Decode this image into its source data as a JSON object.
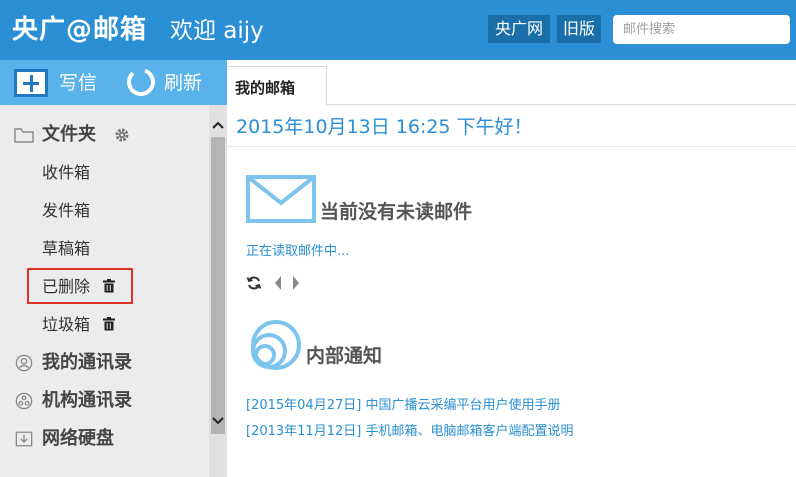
{
  "header": {
    "brand": "央广@邮箱",
    "welcome": "欢迎 aijy",
    "buttons": [
      "央广网",
      "旧版"
    ],
    "search_placeholder": "邮件搜索"
  },
  "toolbar": {
    "write_label": "写信",
    "refresh_label": "刷新"
  },
  "tabs": [
    {
      "label": "我的邮箱"
    }
  ],
  "sidebar": {
    "folders_label": "文件夹",
    "folder_items": [
      {
        "label": "收件箱"
      },
      {
        "label": "发件箱"
      },
      {
        "label": "草稿箱"
      },
      {
        "label": "已删除"
      },
      {
        "label": "垃圾箱"
      }
    ],
    "sections": [
      {
        "label": "我的通讯录"
      },
      {
        "label": "机构通讯录"
      },
      {
        "label": "网络硬盘"
      }
    ]
  },
  "main": {
    "greeting": "2015年10月13日 16:25  下午好！",
    "unread_heading": "当前没有未读邮件",
    "reading_text": "正在读取邮件中...",
    "notice_heading": "内部通知",
    "notices": [
      {
        "text": "[2015年04月27日] 中国广播云采编平台用户使用手册"
      },
      {
        "text": "[2013年11月12日] 手机邮箱、电脑邮箱客户端配置说明"
      }
    ]
  },
  "colors": {
    "header_bg": "#2a8fd4",
    "toolbar_bg": "#5ab2ea",
    "link": "#2a8fd4",
    "highlight": "#e0322a"
  }
}
